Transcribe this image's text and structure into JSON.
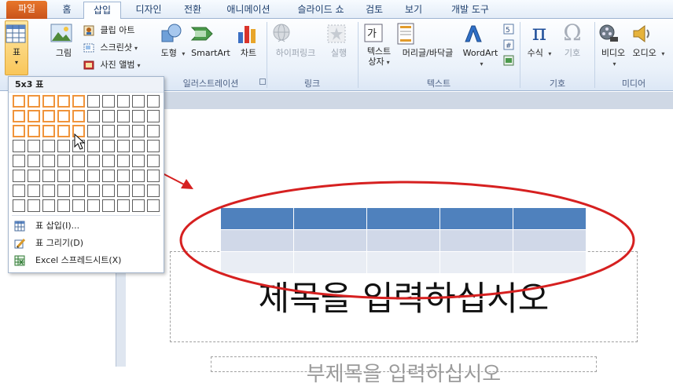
{
  "tabs": [
    "파일",
    "홈",
    "삽입",
    "디자인",
    "전환",
    "애니메이션",
    "슬라이드 쇼",
    "검토",
    "보기",
    "개발 도구"
  ],
  "active_tab": "삽입",
  "ribbon": {
    "table_btn": "표",
    "picture_btn": "그림",
    "clipart_btn": "클립 아트",
    "screenshot_btn": "스크린샷",
    "album_btn": "사진 앨범",
    "shapes_btn": "도형",
    "smartart_btn": "SmartArt",
    "chart_btn": "차트",
    "hyperlink_btn": "하이퍼링크",
    "action_btn": "실행",
    "textbox_btn_line1": "텍스트",
    "textbox_btn_line2": "상자",
    "headerfooter_btn": "머리글/바닥글",
    "wordart_btn": "WordArt",
    "equation_btn": "수식",
    "symbol_btn": "기호",
    "video_btn": "비디오",
    "audio_btn": "오디오",
    "groups": {
      "illustrations": "일러스트레이션",
      "links": "링크",
      "text": "텍스트",
      "symbols": "기호",
      "media": "미디어"
    }
  },
  "table_dropdown": {
    "header": "5x3 표",
    "grid_cols": 10,
    "grid_rows": 8,
    "selected_cols": 5,
    "selected_rows": 3,
    "items": [
      {
        "label": "표 삽입(I)...",
        "icon": "table-icon"
      },
      {
        "label": "표 그리기(D)",
        "icon": "pencil-icon"
      },
      {
        "label": "Excel 스프레드시트(X)",
        "icon": "excel-icon"
      }
    ]
  },
  "slide": {
    "title_placeholder": "제목을 입력하십시오",
    "subtitle_placeholder": "부제목을 입력하십시오"
  },
  "colors": {
    "table_header": "#4f81bd",
    "table_row_odd": "#d0d8e8",
    "table_row_even": "#e9edf4",
    "annotation": "#d62020",
    "grid_selected": "#f0943b"
  }
}
